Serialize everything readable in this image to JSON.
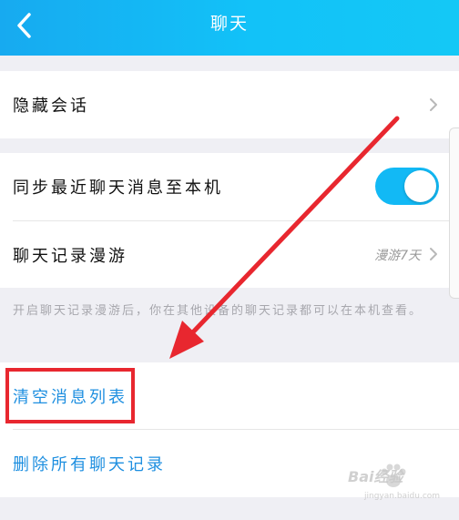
{
  "header": {
    "title": "聊天"
  },
  "rows": {
    "hidden_chat": {
      "label": "隐藏会话"
    },
    "sync": {
      "label": "同步最近聊天消息至本机",
      "toggle_on": true
    },
    "roaming": {
      "label": "聊天记录漫游",
      "value": "漫游7天"
    }
  },
  "note": "开启聊天记录漫游后，你在其他设备的聊天记录都可以在本机查看。",
  "actions": {
    "clear_list": "清空消息列表",
    "delete_all": "删除所有聊天记录"
  },
  "watermark": {
    "text": "Bai经验",
    "sub": "jingyan.baidu.com"
  },
  "colors": {
    "header": "#12c2f8",
    "toggle": "#12b9f5",
    "action_text": "#1e8fe0",
    "annotation": "#e8272f"
  },
  "icons": {
    "back": "chevron-left-icon",
    "row_arrow": "chevron-right-icon"
  }
}
